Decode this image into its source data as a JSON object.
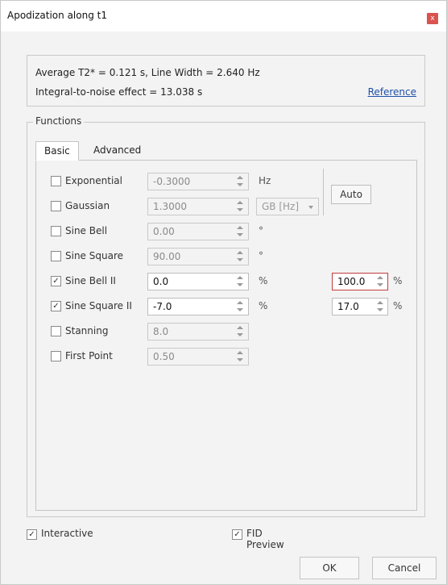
{
  "window": {
    "title": "Apodization along t1",
    "close_glyph": "x"
  },
  "info": {
    "line1": "Average T2* = 0.121 s, Line Width = 2.640 Hz",
    "line2": "Integral-to-noise effect = 13.038 s",
    "reference_link": "Reference"
  },
  "functions": {
    "legend": "Functions",
    "tabs": [
      {
        "label": "Basic",
        "selected": true
      },
      {
        "label": "Advanced",
        "selected": false
      }
    ],
    "rows": [
      {
        "label": "Exponential",
        "checked": false,
        "check_glyph": "",
        "value": "-0.3000",
        "unit": "Hz",
        "enabled": false
      },
      {
        "label": "Gaussian",
        "checked": false,
        "check_glyph": "",
        "value": "1.3000",
        "unit": "",
        "enabled": false
      },
      {
        "label": "Sine Bell",
        "checked": false,
        "check_glyph": "",
        "value": "0.00",
        "unit": "°",
        "enabled": false
      },
      {
        "label": "Sine Square",
        "checked": false,
        "check_glyph": "",
        "value": "90.00",
        "unit": "°",
        "enabled": false
      },
      {
        "label": "Sine Bell II",
        "checked": true,
        "check_glyph": "✓",
        "value": "0.0",
        "unit": "%",
        "enabled": true,
        "end_value": "100.0",
        "end_unit": "%"
      },
      {
        "label": "Sine Square II",
        "checked": true,
        "check_glyph": "✓",
        "value": "-7.0",
        "unit": "%",
        "enabled": true,
        "end_value": "17.0",
        "end_unit": "%"
      },
      {
        "label": "Stanning",
        "checked": false,
        "check_glyph": "",
        "value": "8.0",
        "unit": "",
        "enabled": false
      },
      {
        "label": "First Point",
        "checked": false,
        "check_glyph": "",
        "value": "0.50",
        "unit": "",
        "enabled": false
      }
    ],
    "gaussian_units": "GB [Hz]",
    "auto_button": "Auto"
  },
  "footer": {
    "interactive": {
      "label": "Interactive",
      "checked": true,
      "glyph": "✓"
    },
    "fid_preview": {
      "label": "FID Preview",
      "checked": true,
      "glyph": "✓"
    },
    "ok": "OK",
    "cancel": "Cancel"
  },
  "icons": {
    "spinner": "up-down-spinner-icon",
    "dropdown": "chevron-down-icon",
    "close": "close-icon"
  },
  "colors": {
    "close_button": "#d9534f",
    "link": "#1f4fa8",
    "focus_border": "#c43c3c"
  }
}
